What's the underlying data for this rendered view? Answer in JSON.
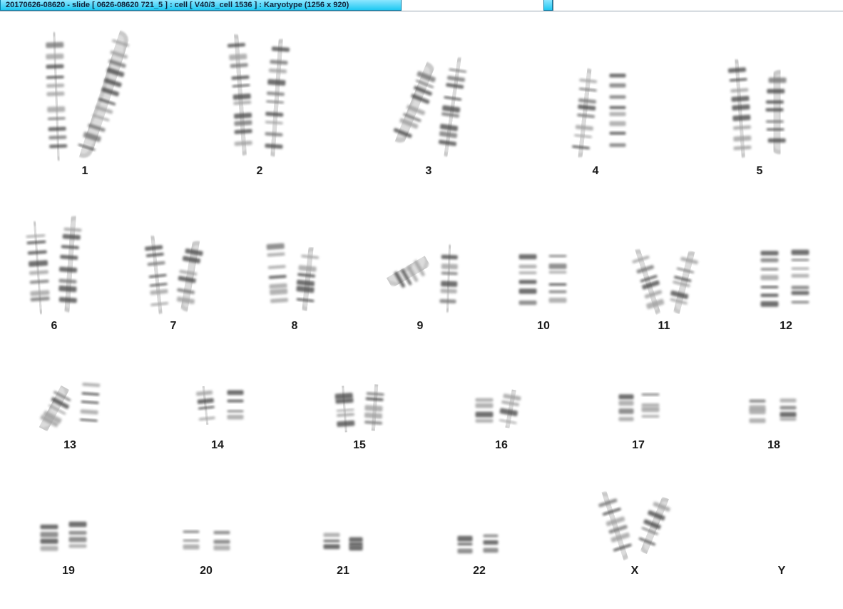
{
  "window": {
    "title": "20170626-08620 - slide [ 0626-08620 721_5 ] : cell [ V40/3_cell 1536 ] : Karyotype  (1256 x 920)"
  },
  "karyotype": {
    "chromosomes": [
      {
        "label": "1"
      },
      {
        "label": "2"
      },
      {
        "label": "3"
      },
      {
        "label": "4"
      },
      {
        "label": "5"
      },
      {
        "label": "6"
      },
      {
        "label": "7"
      },
      {
        "label": "8"
      },
      {
        "label": "9"
      },
      {
        "label": "10"
      },
      {
        "label": "11"
      },
      {
        "label": "12"
      },
      {
        "label": "13"
      },
      {
        "label": "14"
      },
      {
        "label": "15"
      },
      {
        "label": "16"
      },
      {
        "label": "17"
      },
      {
        "label": "18"
      },
      {
        "label": "19"
      },
      {
        "label": "20"
      },
      {
        "label": "21"
      },
      {
        "label": "22"
      },
      {
        "label": "X"
      },
      {
        "label": "Y"
      }
    ]
  }
}
